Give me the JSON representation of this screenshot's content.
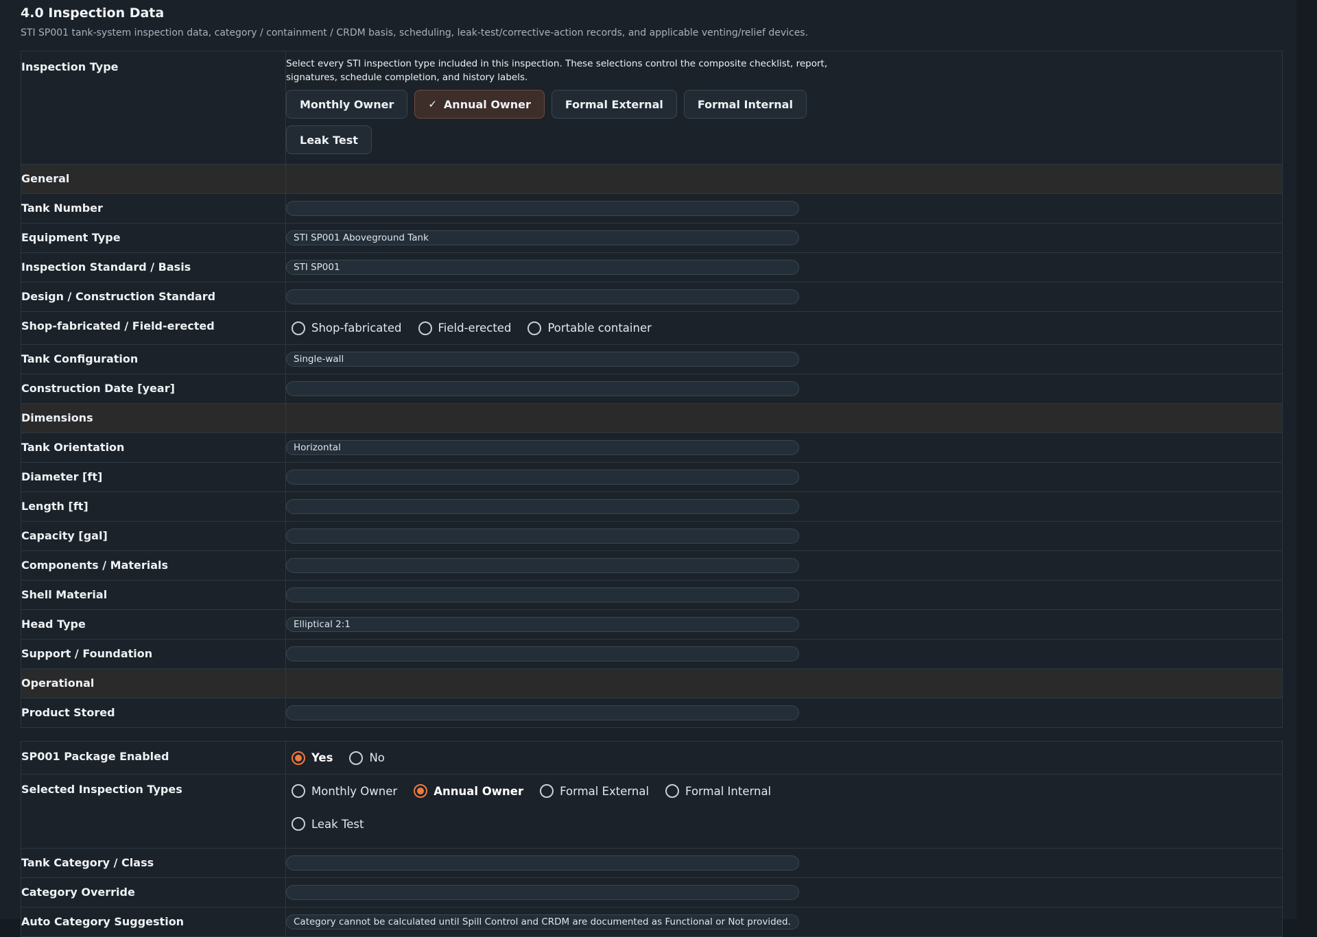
{
  "section": {
    "title": "4.0 Inspection Data",
    "description": "STI SP001 tank-system inspection data, category / containment / CRDM basis, scheduling, leak-test/corrective-action records, and applicable venting/relief devices."
  },
  "inspection_type": {
    "label": "Inspection Type",
    "help": "Select every STI inspection type included in this inspection. These selections control the composite checklist, report, signatures, schedule completion, and history labels.",
    "options": [
      {
        "label": "Monthly Owner",
        "selected": false
      },
      {
        "label": "Annual Owner",
        "selected": true
      },
      {
        "label": "Formal External",
        "selected": false
      },
      {
        "label": "Formal Internal",
        "selected": false
      },
      {
        "label": "Leak Test",
        "selected": false
      }
    ],
    "check_icon": "✓"
  },
  "headers": {
    "general": "General",
    "dimensions": "Dimensions",
    "operational": "Operational"
  },
  "fields": {
    "tank_number": {
      "label": "Tank Number",
      "value": ""
    },
    "equipment_type": {
      "label": "Equipment Type",
      "value": "STI SP001 Aboveground Tank"
    },
    "inspection_standard": {
      "label": "Inspection Standard / Basis",
      "value": "STI SP001"
    },
    "design_standard": {
      "label": "Design / Construction Standard",
      "value": ""
    },
    "fabrication": {
      "label": "Shop-fabricated / Field-erected",
      "options": [
        "Shop-fabricated",
        "Field-erected",
        "Portable container"
      ]
    },
    "tank_configuration": {
      "label": "Tank Configuration",
      "value": "Single-wall"
    },
    "construction_date": {
      "label": "Construction Date [year]",
      "value": ""
    },
    "tank_orientation": {
      "label": "Tank Orientation",
      "value": "Horizontal"
    },
    "diameter": {
      "label": "Diameter [ft]",
      "value": ""
    },
    "length": {
      "label": "Length [ft]",
      "value": ""
    },
    "capacity": {
      "label": "Capacity [gal]",
      "value": ""
    },
    "components": {
      "label": "Components / Materials",
      "value": ""
    },
    "shell_material": {
      "label": "Shell Material",
      "value": ""
    },
    "head_type": {
      "label": "Head Type",
      "value": "Elliptical 2:1"
    },
    "support": {
      "label": "Support / Foundation",
      "value": ""
    },
    "product_stored": {
      "label": "Product Stored",
      "value": ""
    }
  },
  "sp001": {
    "package_label": "SP001 Package Enabled",
    "package_options": [
      {
        "label": "Yes",
        "selected": true
      },
      {
        "label": "No",
        "selected": false
      }
    ],
    "selected_types_label": "Selected Inspection Types",
    "selected_types_options": [
      {
        "label": "Monthly Owner",
        "selected": false
      },
      {
        "label": "Annual Owner",
        "selected": true
      },
      {
        "label": "Formal External",
        "selected": false
      },
      {
        "label": "Formal Internal",
        "selected": false
      },
      {
        "label": "Leak Test",
        "selected": false
      }
    ],
    "tank_category": {
      "label": "Tank Category / Class",
      "value": ""
    },
    "category_override": {
      "label": "Category Override",
      "value": ""
    },
    "auto_category": {
      "label": "Auto Category Suggestion",
      "value": "Category cannot be calculated until Spill Control and CRDM are documented as Functional or Not provided."
    }
  },
  "colors": {
    "accent": "#ef7a3d",
    "background": "#1a2129",
    "header_row": "#2a2a2b"
  }
}
